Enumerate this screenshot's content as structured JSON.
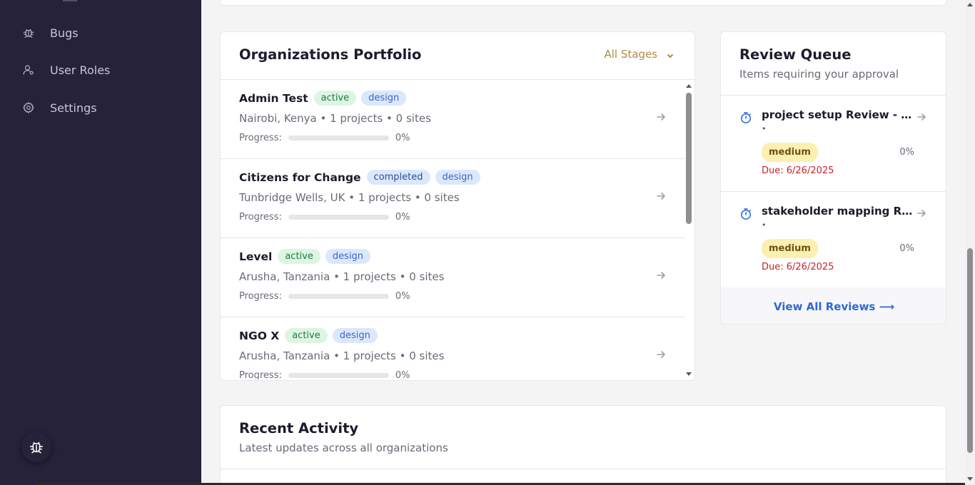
{
  "sidebar": {
    "items": [
      {
        "label": "Bugs",
        "icon": "bug-icon"
      },
      {
        "label": "User Roles",
        "icon": "user-roles-icon"
      },
      {
        "label": "Settings",
        "icon": "gear-icon"
      }
    ],
    "fab_icon": "bug-icon"
  },
  "portfolio": {
    "title": "Organizations Portfolio",
    "stage_filter": "All Stages",
    "progress_label": "Progress:",
    "orgs": [
      {
        "name": "Admin Test",
        "status": "active",
        "stage": "design",
        "meta": "Nairobi, Kenya • 1 projects • 0 sites",
        "progress": "0%"
      },
      {
        "name": "Citizens for Change",
        "status": "completed",
        "stage": "design",
        "meta": "Tunbridge Wells, UK • 1 projects • 0 sites",
        "progress": "0%"
      },
      {
        "name": "Level",
        "status": "active",
        "stage": "design",
        "meta": "Arusha, Tanzania • 1 projects • 0 sites",
        "progress": "0%"
      },
      {
        "name": "NGO X",
        "status": "active",
        "stage": "design",
        "meta": "Arusha, Tanzania • 1 projects • 0 sites",
        "progress": "0%"
      }
    ]
  },
  "review": {
    "title": "Review Queue",
    "subtitle": "Items requiring your approval",
    "items": [
      {
        "title": "project setup Review - Ex...",
        "dot": "•",
        "priority": "medium",
        "progress": "0%",
        "due": "Due: 6/26/2025"
      },
      {
        "title": "stakeholder mapping Rev...",
        "dot": "•",
        "priority": "medium",
        "progress": "0%",
        "due": "Due: 6/26/2025"
      }
    ],
    "view_all": "View All Reviews ⟶"
  },
  "activity": {
    "title": "Recent Activity",
    "subtitle": "Latest updates across all organizations"
  },
  "colors": {
    "sidebar_bg": "#25223a",
    "accent_gold": "#b08a47",
    "link_blue": "#2f68d3",
    "due_red": "#c5222c"
  }
}
